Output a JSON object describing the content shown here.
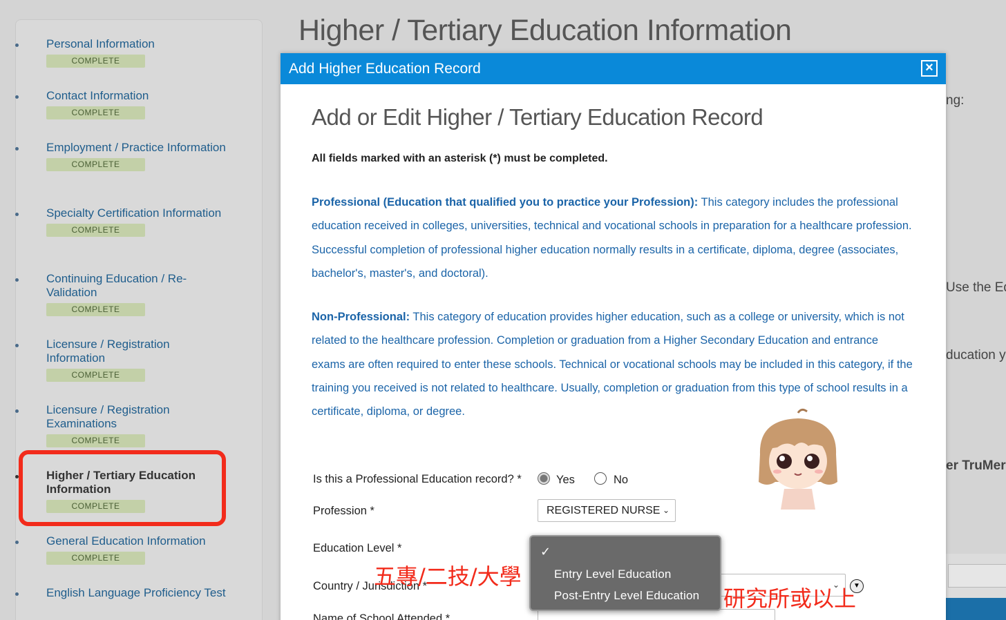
{
  "page_title": "Higher / Tertiary Education Information",
  "background_fragments": [
    "ng:",
    "Use the Edi",
    "ducation yo",
    "er TruMerit"
  ],
  "sidebar": {
    "items": [
      {
        "label": "Personal Information",
        "status": "COMPLETE"
      },
      {
        "label": "Contact Information",
        "status": "COMPLETE"
      },
      {
        "label": "Employment / Practice Information",
        "status": "COMPLETE"
      },
      {
        "label": "Specialty Certification Information",
        "status": "COMPLETE"
      },
      {
        "label": "Continuing Education / Re-Validation",
        "status": "COMPLETE"
      },
      {
        "label": "Licensure / Registration Information",
        "status": "COMPLETE"
      },
      {
        "label": "Licensure / Registration Examinations",
        "status": "COMPLETE"
      },
      {
        "label": "Higher / Tertiary Education Information",
        "status": "COMPLETE"
      },
      {
        "label": "General Education Information",
        "status": "COMPLETE"
      },
      {
        "label": "English Language Proficiency Test",
        "status": ""
      }
    ]
  },
  "modal": {
    "header": "Add Higher Education Record",
    "close_icon": "×",
    "title": "Add or Edit Higher / Tertiary Education Record",
    "required_note": "All fields marked with an asterisk (*) must be completed.",
    "professional": {
      "term": "Professional (Education that qualified you to practice your Profession):",
      "text": " This category includes the professional education received in colleges, universities, technical and vocational schools in preparation for a healthcare profession. Successful completion of professional higher education normally results in a certificate, diploma, degree (associates, bachelor's, master's, and doctoral)."
    },
    "non_professional": {
      "term": "Non-Professional:",
      "text": " This category of education provides higher education, such as a college or university, which is not related to the healthcare profession. Completion or graduation from a Higher Secondary Education and entrance exams are often required to enter these schools. Technical or vocational schools may be included in this category, if the training you received is not related to healthcare. Usually, completion or graduation from this type of school results in a certificate, diploma, or degree."
    },
    "form": {
      "professional_question": "Is this a Professional Education record? *",
      "yes": "Yes",
      "no": "No",
      "profession_label": "Profession *",
      "profession_value": "REGISTERED NURSE",
      "education_level_label": "Education Level *",
      "country_label": "Country / Jurisdiction *",
      "school_label": "Name of School Attended *"
    },
    "education_level_options": [
      "Entry Level Education",
      "Post-Entry Level Education"
    ],
    "check_mark": "✓"
  },
  "annotations": {
    "left": "五專/二技/大學",
    "right": "研究所或以上"
  },
  "colors": {
    "modal_header": "#0a89d9",
    "link_blue": "#1b64a8",
    "badge_green": "#c3d0a8",
    "highlight_red": "#f22b1b"
  }
}
